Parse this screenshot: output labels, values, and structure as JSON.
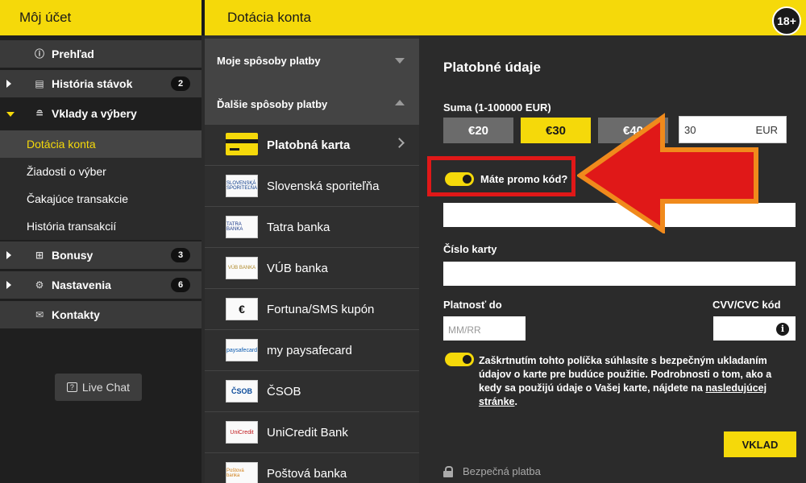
{
  "header": {
    "left_title": "Môj účet",
    "right_title": "Dotácia konta",
    "age_badge": "18+"
  },
  "sidebar": {
    "items": [
      {
        "label": "Prehľad",
        "icon": "info-icon"
      },
      {
        "label": "História stávok",
        "icon": "receipt-icon",
        "badge": "2"
      },
      {
        "label": "Vklady a výbery",
        "icon": "coins-icon"
      },
      {
        "label": "Bonusy",
        "icon": "gift-icon",
        "badge": "3"
      },
      {
        "label": "Nastavenia",
        "icon": "gears-icon",
        "badge": "6"
      },
      {
        "label": "Kontakty",
        "icon": "mail-icon"
      }
    ],
    "sub_items": [
      {
        "label": "Dotácia konta",
        "active": true
      },
      {
        "label": "Žiadosti o výber"
      },
      {
        "label": "Čakajúce transakcie"
      },
      {
        "label": "História transakcií"
      }
    ],
    "live_chat": "Live Chat"
  },
  "methods": {
    "my_methods": "Moje spôsoby platby",
    "other_methods": "Ďalšie spôsoby platby",
    "list": [
      {
        "label": "Platobná karta",
        "logo": "card-icon",
        "active": true
      },
      {
        "label": "Slovenská sporiteľňa",
        "logo_text": "SLOVENSKÁ SPORITEĽŇA"
      },
      {
        "label": "Tatra banka",
        "logo_text": "TATRA BANKA"
      },
      {
        "label": "VÚB banka",
        "logo_text": "VÚB BANKA"
      },
      {
        "label": "Fortuna/SMS kupón",
        "logo_text": "€"
      },
      {
        "label": "my paysafecard",
        "logo_text": "paysafecard"
      },
      {
        "label": "ČSOB",
        "logo_text": "ČSOB"
      },
      {
        "label": "UniCredit Bank",
        "logo_text": "UniCredit"
      },
      {
        "label": "Poštová banka",
        "logo_text": "Poštová banka"
      }
    ]
  },
  "form": {
    "title": "Platobné údaje",
    "amount_label": "Suma (1-100000 EUR)",
    "amounts": [
      "€20",
      "€30",
      "€40"
    ],
    "selected_amount_index": 1,
    "amount_value": "30",
    "currency": "EUR",
    "promo_label": "Máte promo kód?",
    "card_number_label": "Číslo karty",
    "expiry_label": "Platnosť do",
    "expiry_placeholder": "MM/RR",
    "cvv_label": "CVV/CVC kód",
    "consent_text": "Zaškrtnutím tohto políčka súhlasíte s bezpečným ukladaním údajov o karte pre budúce použitie. Podrobnosti o tom, ako a kedy sa použijú údaje o Vašej karte, nájdete na ",
    "consent_link": "nasledujúcej stránke",
    "consent_end": ".",
    "submit": "VKLAD",
    "secure": "Bezpečná platba"
  },
  "colors": {
    "brand_yellow": "#f5d90a",
    "annotation_red": "#e01818",
    "annotation_orange": "#f08a1c"
  }
}
